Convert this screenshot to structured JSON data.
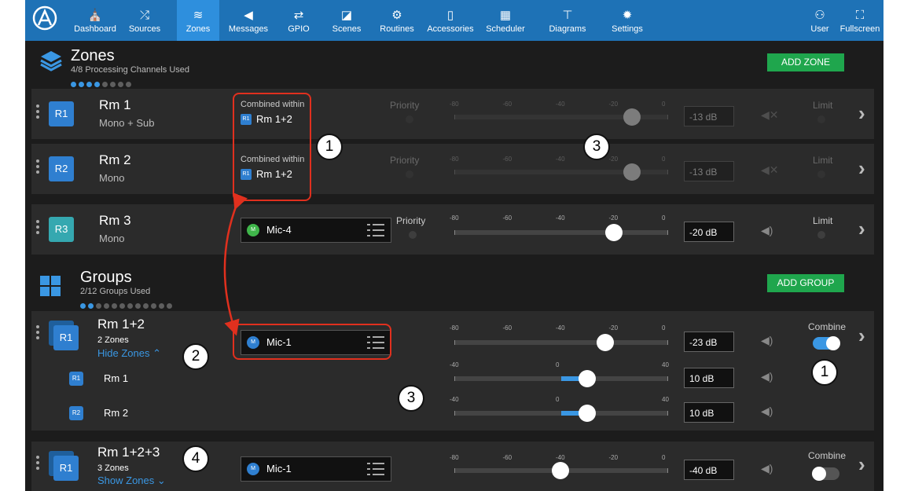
{
  "nav": {
    "items": [
      {
        "label": "Dashboard",
        "icon": "dashboard-icon",
        "glyph": "⛪"
      },
      {
        "label": "Sources",
        "icon": "shuffle-icon",
        "glyph": "⤮"
      },
      {
        "label": "Zones",
        "icon": "layers-icon",
        "glyph": "≋",
        "active": true
      },
      {
        "label": "Messages",
        "icon": "megaphone-icon",
        "glyph": "◀"
      },
      {
        "label": "GPIO",
        "icon": "gpio-icon",
        "glyph": "⇄"
      },
      {
        "label": "Scenes",
        "icon": "scenes-icon",
        "glyph": "◪"
      },
      {
        "label": "Routines",
        "icon": "routines-icon",
        "glyph": "⚙"
      },
      {
        "label": "Accessories",
        "icon": "device-icon",
        "glyph": "▯"
      },
      {
        "label": "Scheduler",
        "icon": "calendar-icon",
        "glyph": "▦"
      },
      {
        "label": "Diagrams",
        "icon": "diagram-icon",
        "glyph": "⊤"
      },
      {
        "label": "Settings",
        "icon": "gear-icon",
        "glyph": "✹"
      }
    ],
    "user_label": "User",
    "fullscreen_label": "Fullscreen"
  },
  "zones_section": {
    "title": "Zones",
    "subtitle": "4/8 Processing Channels Used",
    "used": 4,
    "total": 8,
    "add_label": "ADD ZONE"
  },
  "zones": [
    {
      "badge": "R1",
      "name": "Rm 1",
      "sub": "Mono + Sub",
      "combined_label": "Combined within",
      "combined_tag": "R1",
      "combined_name": "Rm 1+2",
      "priority": "Priority",
      "db": "-13 dB",
      "level_db": -13,
      "limit": "Limit"
    },
    {
      "badge": "R2",
      "name": "Rm 2",
      "sub": "Mono",
      "combined_label": "Combined within",
      "combined_tag": "R1",
      "combined_name": "Rm 1+2",
      "priority": "Priority",
      "db": "-13 dB",
      "level_db": -13,
      "limit": "Limit"
    },
    {
      "badge": "R3",
      "name": "Rm 3",
      "sub": "Mono",
      "source_mark": "M",
      "source": "Mic-4",
      "priority": "Priority",
      "db": "-20 dB",
      "level_db": -20,
      "limit": "Limit"
    }
  ],
  "scale_main": [
    "-80",
    "-60",
    "-40",
    "-20",
    "0"
  ],
  "scale_trim": [
    "-40",
    "0",
    "40"
  ],
  "groups_section": {
    "title": "Groups",
    "subtitle": "2/12 Groups Used",
    "used": 2,
    "total": 12,
    "add_label": "ADD GROUP"
  },
  "groups": [
    {
      "badge": "R1",
      "name": "Rm 1+2",
      "count": "2 Zones",
      "toggle": "Hide Zones",
      "source_mark": "M",
      "source": "Mic-1",
      "db": "-23 dB",
      "level_db": -23,
      "combine_label": "Combine",
      "combine_on": true,
      "members": [
        {
          "badge": "R1",
          "name": "Rm 1",
          "db": "10 dB",
          "trim_db": 10
        },
        {
          "badge": "R2",
          "name": "Rm 2",
          "db": "10 dB",
          "trim_db": 10
        }
      ]
    },
    {
      "badge": "R1",
      "name": "Rm 1+2+3",
      "count": "3 Zones",
      "toggle": "Show Zones",
      "source_mark": "M",
      "source": "Mic-1",
      "db": "-40 dB",
      "level_db": -40,
      "combine_label": "Combine",
      "combine_on": false
    }
  ],
  "annotations": [
    "1",
    "1",
    "2",
    "3",
    "3",
    "4"
  ],
  "colors": {
    "nav": "#1e72b6",
    "accent": "#3a97e3",
    "add": "#1fa64d",
    "source_dot": "#3fb54a",
    "source_dot_blue": "#2f7fd0",
    "annotation": "#e0301e"
  }
}
